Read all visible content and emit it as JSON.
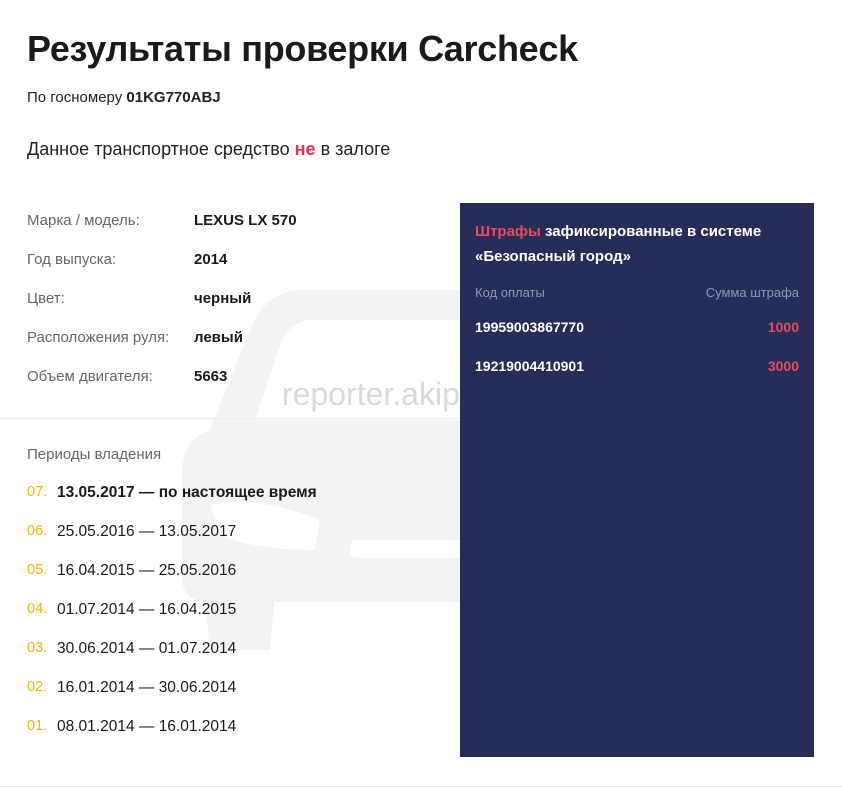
{
  "header": {
    "title": "Результаты проверки Carcheck",
    "plate_prefix": "По госномеру",
    "plate": "01KG770ABJ",
    "status_pre": "Данное транспортное средство",
    "status_neg": "не",
    "status_post": "в залоге"
  },
  "specs": [
    {
      "label": "Марка / модель:",
      "value": "LEXUS LX 570"
    },
    {
      "label": "Год выпуска:",
      "value": "2014"
    },
    {
      "label": "Цвет:",
      "value": "черный"
    },
    {
      "label": "Расположения руля:",
      "value": "левый"
    },
    {
      "label": "Объем двигателя:",
      "value": "5663"
    }
  ],
  "periods": {
    "title": "Периоды владения",
    "items": [
      {
        "num": "07.",
        "dates": "13.05.2017 — по настоящее время"
      },
      {
        "num": "06.",
        "dates": "25.05.2016 — 13.05.2017"
      },
      {
        "num": "05.",
        "dates": "16.04.2015 — 25.05.2016"
      },
      {
        "num": "04.",
        "dates": "01.07.2014 — 16.04.2015"
      },
      {
        "num": "03.",
        "dates": "30.06.2014 — 01.07.2014"
      },
      {
        "num": "02.",
        "dates": "16.01.2014 — 30.06.2014"
      },
      {
        "num": "01.",
        "dates": "08.01.2014 — 16.01.2014"
      }
    ]
  },
  "fines": {
    "title_red": "Штрафы",
    "title_rest": "зафиксированные в системе «Безопасный город»",
    "col_code": "Код оплаты",
    "col_amount": "Сумма штрафа",
    "rows": [
      {
        "code": "19959003867770",
        "amount": "1000"
      },
      {
        "code": "19219004410901",
        "amount": "3000"
      }
    ]
  },
  "watermark": "reporter.akipress.org",
  "colors": {
    "accent_red": "#e84a5f",
    "panel": "#272d57",
    "period_number": "#f5b500"
  }
}
